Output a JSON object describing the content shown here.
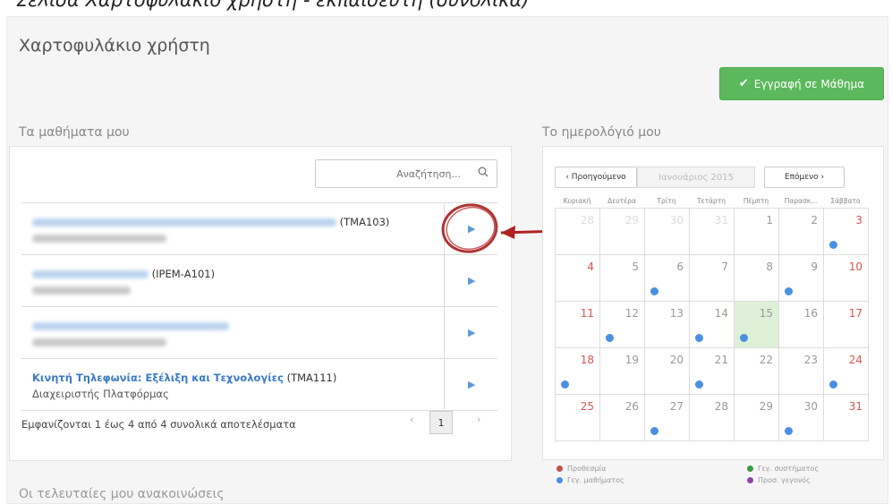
{
  "caption": "Σελίδα Χαρτοφυλάκιο χρήστη - εκπαιδευτή (συνολικά)",
  "page_title": "Χαρτοφυλάκιο χρήστη",
  "register_button": {
    "label": "Εγγραφή σε Μάθημα",
    "color": "#5cb85c"
  },
  "my_courses": {
    "title": "Τα μαθήματα μου",
    "search_placeholder": "Αναζήτηση...",
    "rows": [
      {
        "name": "",
        "code": "(ΤΜΑ103)",
        "sub": ""
      },
      {
        "name": "",
        "code": "(ΙΡΕΜ-Α101)",
        "sub": ""
      },
      {
        "name": "",
        "code": "",
        "sub": ""
      },
      {
        "name": "Κινητή Τηλεφωνία: Εξέλιξη και Τεχνολογίες",
        "code": "(ΤΜΑ111)",
        "sub": "Διαχειριστής Πλατφόρμας"
      }
    ],
    "footer": "Εμφανίζονται 1 έως 4 από 4 συνολικά αποτελέσματα",
    "pager": {
      "prev": "‹",
      "page": "1",
      "next": "›"
    }
  },
  "calendar": {
    "title": "Το ημερολόγιό μου",
    "prev": "‹ Προηγούμενο",
    "month": "Ιανουάριος 2015",
    "next": "Επόμενο ›",
    "weekdays": [
      "Κυριακή",
      "Δευτέρα",
      "Τρίτη",
      "Τετάρτη",
      "Πέμπτη",
      "Παρασκ...",
      "Σάββατο"
    ],
    "weeks": [
      [
        "28",
        "29",
        "30",
        "31",
        "1",
        "2",
        "3"
      ],
      [
        "4",
        "5",
        "6",
        "7",
        "8",
        "9",
        "10"
      ],
      [
        "11",
        "12",
        "13",
        "14",
        "15",
        "16",
        "17"
      ],
      [
        "18",
        "19",
        "20",
        "21",
        "22",
        "23",
        "24"
      ],
      [
        "25",
        "26",
        "27",
        "28",
        "29",
        "30",
        "31"
      ]
    ],
    "legend": [
      {
        "label": "Προθεσμία",
        "color": "#c0504d"
      },
      {
        "label": "Γεγ. συστήματος",
        "color": "#3c9b3c"
      },
      {
        "label": "Γεγ. μαθήματος",
        "color": "#4a90e2"
      },
      {
        "label": "Προσ. γεγονός",
        "color": "#8e44ad"
      }
    ]
  },
  "announcements_title": "Οι τελευταίες μου ανακοινώσεις"
}
